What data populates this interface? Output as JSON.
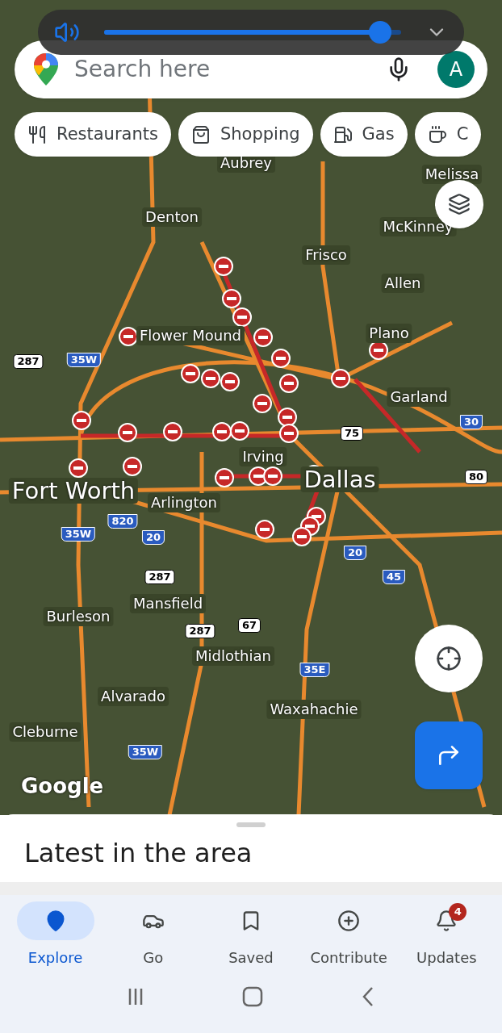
{
  "volume": {
    "level": 0.93
  },
  "search": {
    "placeholder": "Search here",
    "avatar": "A"
  },
  "chips": [
    {
      "label": "Restaurants",
      "kind": "food"
    },
    {
      "label": "Shopping",
      "kind": "shop"
    },
    {
      "label": "Gas",
      "kind": "gas"
    },
    {
      "label": "C",
      "kind": "coffee"
    }
  ],
  "map_labels": [
    {
      "text": "Aubrey",
      "kind": "city"
    },
    {
      "text": "Melissa",
      "kind": "city"
    },
    {
      "text": "Denton",
      "kind": "city"
    },
    {
      "text": "McKinney",
      "kind": "city"
    },
    {
      "text": "Frisco",
      "kind": "city"
    },
    {
      "text": "Allen",
      "kind": "city"
    },
    {
      "text": "Flower Mound",
      "kind": "city"
    },
    {
      "text": "Plano",
      "kind": "city"
    },
    {
      "text": "Garland",
      "kind": "city"
    },
    {
      "text": "Irving",
      "kind": "city"
    },
    {
      "text": "Fort Worth",
      "kind": "major"
    },
    {
      "text": "Arlington",
      "kind": "city"
    },
    {
      "text": "Dallas",
      "kind": "major"
    },
    {
      "text": "Mansfield",
      "kind": "city"
    },
    {
      "text": "Burleson",
      "kind": "city"
    },
    {
      "text": "Midlothian",
      "kind": "city"
    },
    {
      "text": "Alvarado",
      "kind": "city"
    },
    {
      "text": "Waxahachie",
      "kind": "city"
    },
    {
      "text": "Cleburne",
      "kind": "city"
    },
    {
      "text": "35W",
      "kind": "interstate"
    },
    {
      "text": "287",
      "kind": "us"
    },
    {
      "text": "75",
      "kind": "us"
    },
    {
      "text": "30",
      "kind": "interstate"
    },
    {
      "text": "80",
      "kind": "us"
    },
    {
      "text": "820",
      "kind": "interstate"
    },
    {
      "text": "35W",
      "kind": "interstate"
    },
    {
      "text": "20",
      "kind": "interstate"
    },
    {
      "text": "20",
      "kind": "interstate"
    },
    {
      "text": "287",
      "kind": "us"
    },
    {
      "text": "45",
      "kind": "interstate"
    },
    {
      "text": "287",
      "kind": "us"
    },
    {
      "text": "67",
      "kind": "us"
    },
    {
      "text": "35E",
      "kind": "interstate"
    },
    {
      "text": "35W",
      "kind": "interstate"
    }
  ],
  "map_logo": "Google",
  "sheet": {
    "title": "Latest in the area"
  },
  "nav": [
    {
      "label": "Explore",
      "kind": "pin",
      "selected": true
    },
    {
      "label": "Go",
      "kind": "go",
      "selected": false
    },
    {
      "label": "Saved",
      "kind": "bookmark",
      "selected": false
    },
    {
      "label": "Contribute",
      "kind": "plus",
      "selected": false
    },
    {
      "label": "Updates",
      "kind": "bell",
      "selected": false,
      "badge": "4"
    }
  ]
}
